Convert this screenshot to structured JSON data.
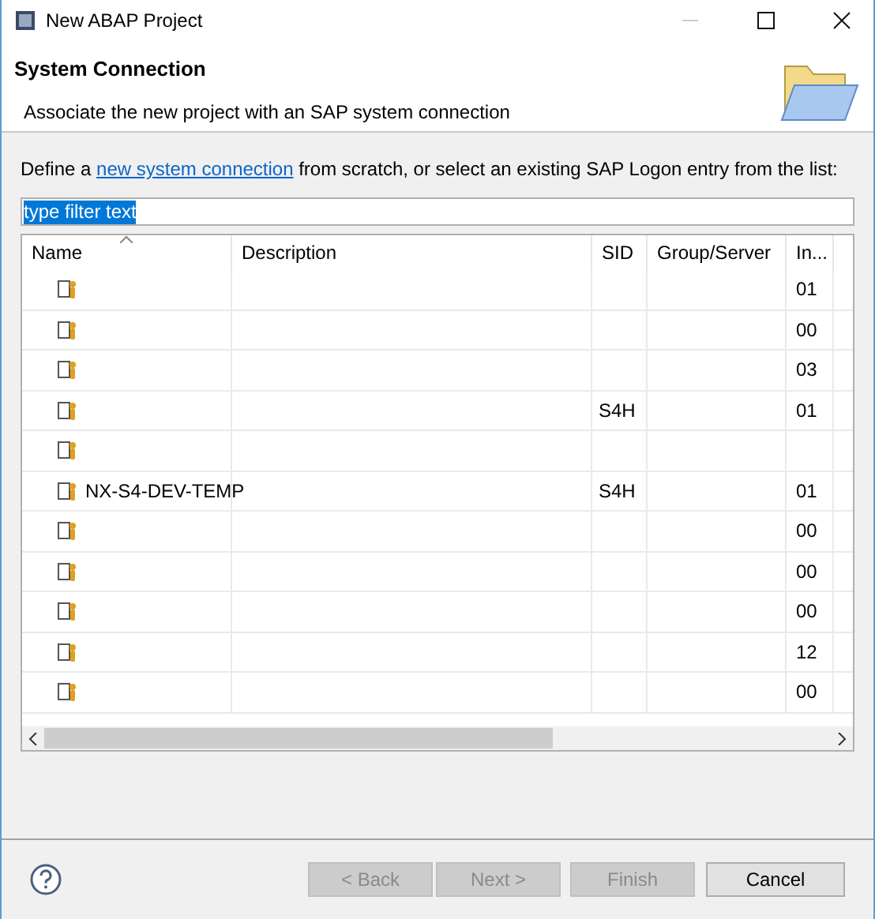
{
  "window": {
    "title": "New ABAP Project"
  },
  "header": {
    "title": "System Connection",
    "subtitle": "Associate the new project with an SAP system connection"
  },
  "intro": {
    "before": "Define a ",
    "link": "new system connection",
    "after": " from scratch, or select an existing SAP Logon entry from the list:"
  },
  "filter": {
    "value": "type filter text"
  },
  "table": {
    "columns": [
      "Name",
      "Description",
      "SID",
      "Group/Server",
      "In..."
    ],
    "rows": [
      {
        "instance": "01"
      },
      {
        "instance": "00"
      },
      {
        "instance": "03"
      },
      {
        "sid": "S4H",
        "instance": "01"
      },
      {},
      {
        "name": "NX-S4-DEV-TEMP",
        "sid": "S4H",
        "instance": "01"
      },
      {
        "instance": "00"
      },
      {
        "instance": "00"
      },
      {
        "instance": "00"
      },
      {
        "instance": "12"
      },
      {
        "instance": "00"
      }
    ]
  },
  "buttons": [
    {
      "label": "< Back",
      "disabled": true
    },
    {
      "label": "Next >",
      "disabled": true
    },
    {
      "label": "Finish",
      "disabled": true
    },
    {
      "label": "Cancel",
      "disabled": false
    }
  ]
}
